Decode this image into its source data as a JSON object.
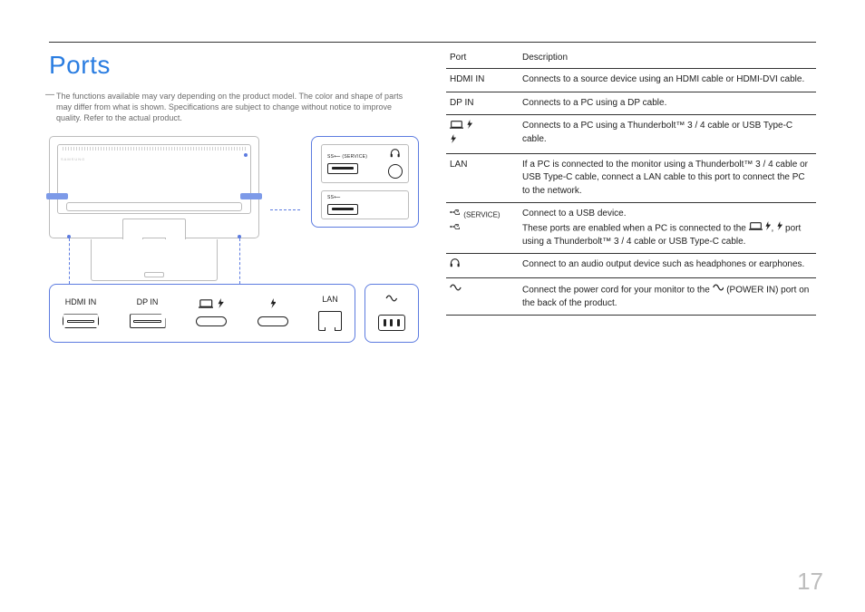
{
  "page": {
    "title": "Ports",
    "note": "The functions available may vary depending on the product model. The color and shape of parts may differ from what is shown. Specifications are subject to change without notice to improve quality. Refer to the actual product.",
    "number": "17"
  },
  "callout": {
    "usb_service_label": "SS⟵ (SERVICE)",
    "usb_label": "SS⟵"
  },
  "port_panel": {
    "hdmi": "HDMI IN",
    "dp": "DP IN",
    "lan": "LAN"
  },
  "table": {
    "headers": {
      "port": "Port",
      "desc": "Description"
    },
    "rows": [
      {
        "port_text": "HDMI IN",
        "icon": "none",
        "desc": "Connects to a source device using an HDMI cable or HDMI-DVI cable."
      },
      {
        "port_text": "DP IN",
        "icon": "none",
        "desc": "Connects to a PC using a DP cable."
      },
      {
        "port_text": "",
        "icon": "tb-stack",
        "desc": "Connects to a PC using a Thunderbolt™ 3 / 4 cable or USB Type-C cable."
      },
      {
        "port_text": "LAN",
        "icon": "none",
        "desc": "If a PC is connected to the monitor using a Thunderbolt™ 3 / 4 cable or USB Type-C cable, connect a LAN cable to this port to connect the PC to the network."
      },
      {
        "port_text": "",
        "icon": "usb-ss",
        "desc_prefix": "Connect to a USB device.",
        "desc_rest_a": "These ports are enabled when a PC is connected to the ",
        "desc_rest_b": " port using a Thunderbolt™ 3 / 4 cable or USB Type-C cable."
      },
      {
        "port_text": "",
        "icon": "headphones",
        "desc": "Connect to an audio output device such as headphones or earphones."
      },
      {
        "port_text": "",
        "icon": "sine",
        "desc_a": "Connect the power cord for your monitor to the ",
        "desc_b": " (POWER IN) port on the back of the product."
      }
    ]
  }
}
